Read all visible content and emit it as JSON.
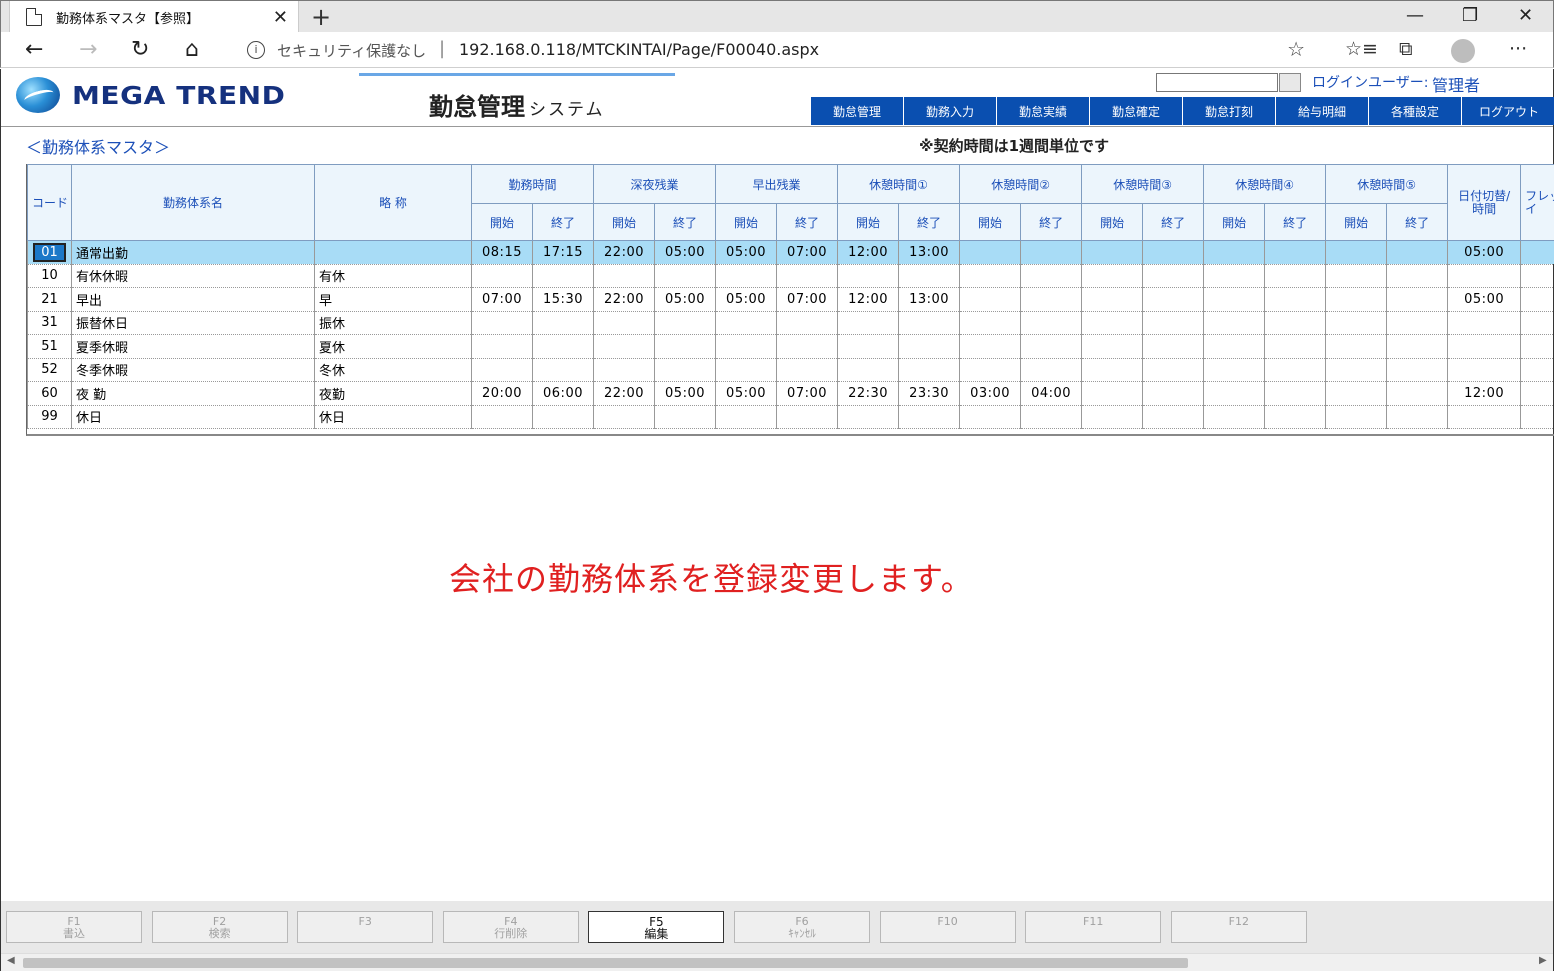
{
  "browser": {
    "tab_title": "勤務体系マスタ【参照】",
    "security": "セキュリティ保護なし",
    "url": "192.168.0.118/MTCKINTAI/Page/F00040.aspx"
  },
  "header": {
    "logo_text": "MEGA TREND",
    "title_main": "勤怠管理",
    "title_sub": "システム",
    "login_label": "ログインユーザー:",
    "login_user": "管理者",
    "menu": [
      "勤怠管理",
      "勤務入力",
      "勤怠実績",
      "勤怠確定",
      "勤怠打刻",
      "給与明細",
      "各種設定",
      "ログアウト"
    ]
  },
  "page": {
    "heading": "＜勤務体系マスタ＞",
    "notice": "※契約時間は1週間単位です",
    "message": "会社の勤務体系を登録変更します。"
  },
  "table": {
    "col_code": "コード",
    "col_name": "勤務体系名",
    "col_abbr": "略 称",
    "groups": [
      "勤務時間",
      "深夜残業",
      "早出残業",
      "休憩時間①",
      "休憩時間②",
      "休憩時間③",
      "休憩時間④",
      "休憩時間⑤"
    ],
    "sub_start": "開始",
    "sub_end": "終了",
    "col_date_switch": "日付切替/時間",
    "col_flex": "フレッ タイ",
    "rows": [
      {
        "code": "01",
        "name": "通常出勤",
        "abbr": "",
        "times": [
          "08:15",
          "17:15",
          "22:00",
          "05:00",
          "05:00",
          "07:00",
          "12:00",
          "13:00",
          "",
          "",
          "",
          "",
          "",
          "",
          "",
          ""
        ],
        "switch": "05:00"
      },
      {
        "code": "10",
        "name": "有休休暇",
        "abbr": "有休",
        "times": [
          "",
          "",
          "",
          "",
          "",
          "",
          "",
          "",
          "",
          "",
          "",
          "",
          "",
          "",
          "",
          ""
        ],
        "switch": ""
      },
      {
        "code": "21",
        "name": "早出",
        "abbr": "早",
        "times": [
          "07:00",
          "15:30",
          "22:00",
          "05:00",
          "05:00",
          "07:00",
          "12:00",
          "13:00",
          "",
          "",
          "",
          "",
          "",
          "",
          "",
          ""
        ],
        "switch": "05:00"
      },
      {
        "code": "31",
        "name": "振替休日",
        "abbr": "振休",
        "times": [
          "",
          "",
          "",
          "",
          "",
          "",
          "",
          "",
          "",
          "",
          "",
          "",
          "",
          "",
          "",
          ""
        ],
        "switch": ""
      },
      {
        "code": "51",
        "name": "夏季休暇",
        "abbr": "夏休",
        "times": [
          "",
          "",
          "",
          "",
          "",
          "",
          "",
          "",
          "",
          "",
          "",
          "",
          "",
          "",
          "",
          ""
        ],
        "switch": ""
      },
      {
        "code": "52",
        "name": "冬季休暇",
        "abbr": "冬休",
        "times": [
          "",
          "",
          "",
          "",
          "",
          "",
          "",
          "",
          "",
          "",
          "",
          "",
          "",
          "",
          "",
          ""
        ],
        "switch": ""
      },
      {
        "code": "60",
        "name": "夜 勤",
        "abbr": "夜勤",
        "times": [
          "20:00",
          "06:00",
          "22:00",
          "05:00",
          "05:00",
          "07:00",
          "22:30",
          "23:30",
          "03:00",
          "04:00",
          "",
          "",
          "",
          "",
          "",
          ""
        ],
        "switch": "12:00"
      },
      {
        "code": "99",
        "name": "休日",
        "abbr": "休日",
        "times": [
          "",
          "",
          "",
          "",
          "",
          "",
          "",
          "",
          "",
          "",
          "",
          "",
          "",
          "",
          "",
          ""
        ],
        "switch": ""
      }
    ]
  },
  "fkeys": [
    {
      "key": "F1",
      "label": "書込"
    },
    {
      "key": "F2",
      "label": "検索"
    },
    {
      "key": "F3",
      "label": ""
    },
    {
      "key": "F4",
      "label": "行削除"
    },
    {
      "key": "F5",
      "label": "編集"
    },
    {
      "key": "F6",
      "label": "ｷｬﾝｾﾙ"
    },
    {
      "key": "F10",
      "label": ""
    },
    {
      "key": "F11",
      "label": ""
    },
    {
      "key": "F12",
      "label": ""
    }
  ],
  "colors": {
    "menu_bg": "#0a4fb0",
    "selected_row": "#a8dcf6",
    "message": "#e02020",
    "link_blue": "#1b4fb8"
  }
}
